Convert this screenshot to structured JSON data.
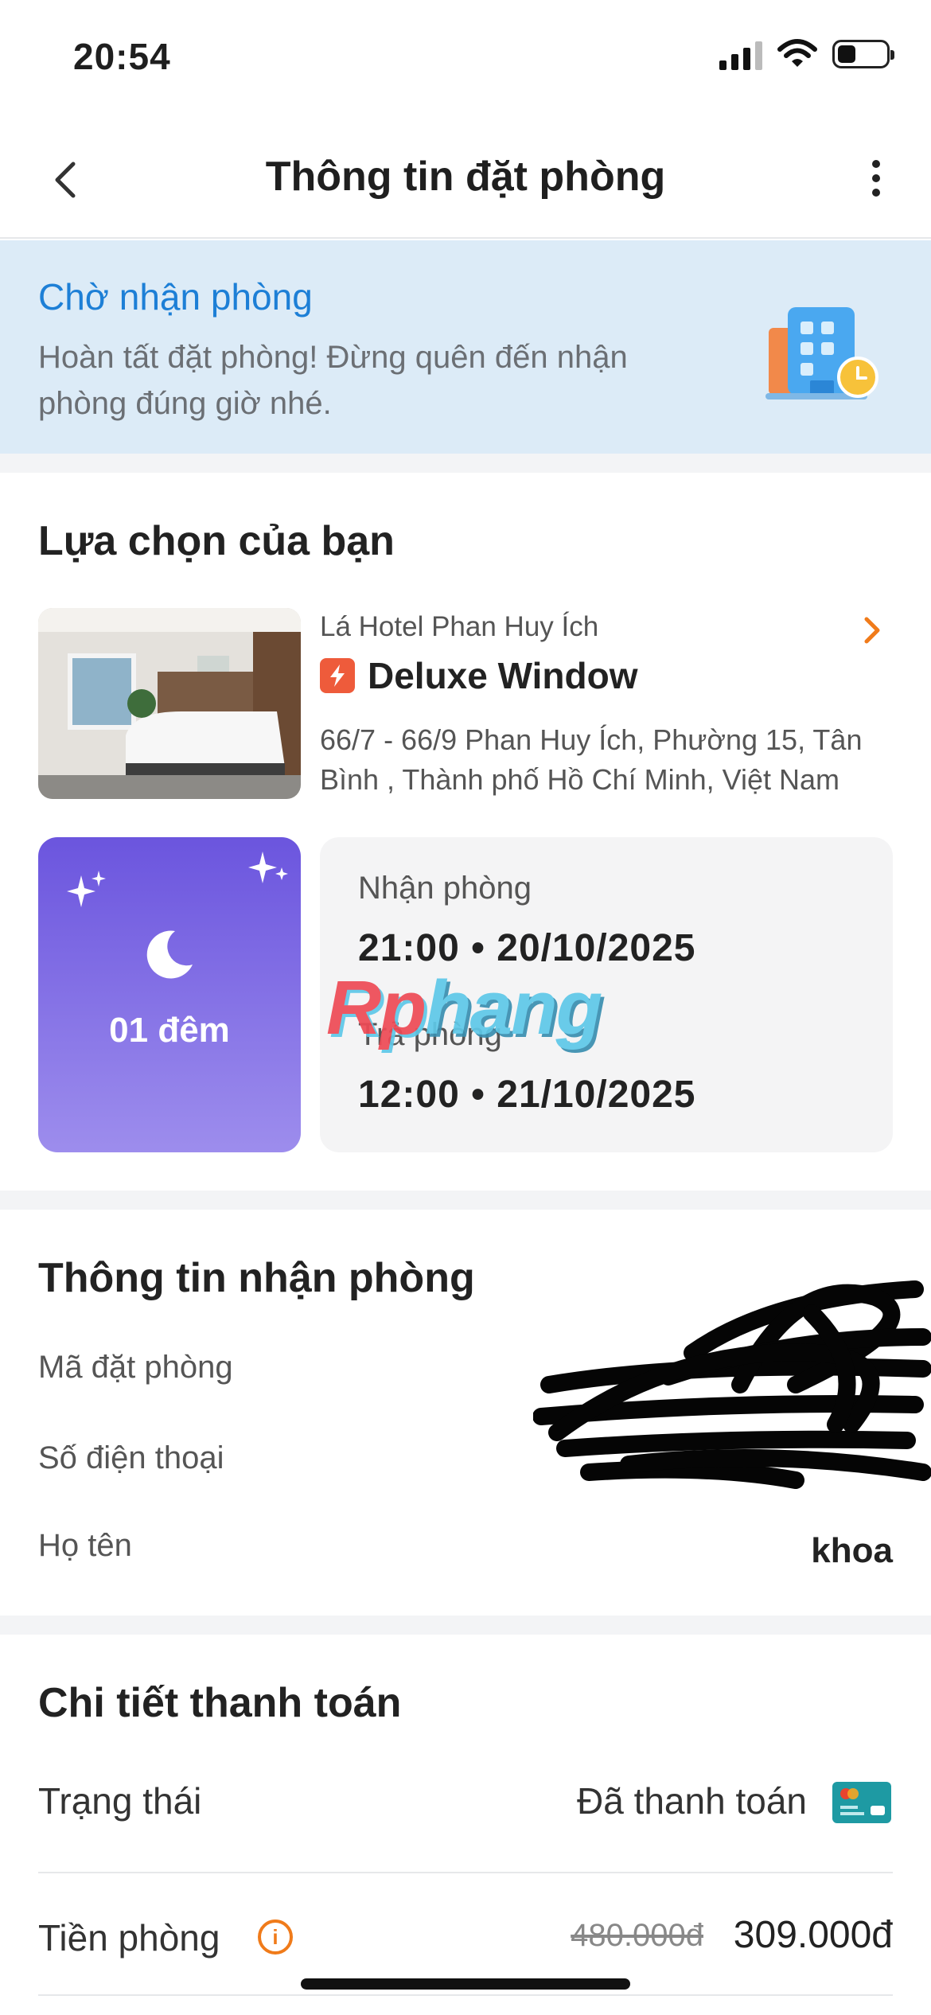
{
  "status_bar": {
    "time": "20:54"
  },
  "nav": {
    "title": "Thông tin đặt phòng"
  },
  "banner": {
    "title": "Chờ nhận phòng",
    "message": "Hoàn tất đặt phòng! Đừng quên đến nhận phòng đúng giờ nhé."
  },
  "selection": {
    "title": "Lựa chọn của bạn",
    "hotel_name": "Lá Hotel Phan Huy Ích",
    "room_name": "Deluxe Window",
    "address": "66/7 - 66/9  Phan Huy Ích, Phường 15, Tân Bình , Thành phố Hồ Chí Minh, Việt Nam",
    "nights": "01 đêm",
    "checkin_label": "Nhận phòng",
    "checkin_value": "21:00  •  20/10/2025",
    "checkout_label": "Trả phòng",
    "checkout_value": "12:00  •  21/10/2025"
  },
  "watermark": {
    "part1": "Rp",
    "part2": "hang"
  },
  "checkin_info": {
    "title": "Thông tin nhận phòng",
    "booking_code_label": "Mã đặt phòng",
    "phone_label": "Số điện thoại",
    "name_label": "Họ tên",
    "name_value": "khoa"
  },
  "payment": {
    "title": "Chi tiết thanh toán",
    "status_label": "Trạng thái",
    "status_value": "Đã thanh toán",
    "room_price_label": "Tiền phòng",
    "info_icon": "i",
    "original_price": "480.000đ",
    "price": "309.000đ"
  },
  "colors": {
    "accent_blue": "#1d7fd6",
    "banner_bg": "#dcebf7",
    "nights_purple": "#6b55de",
    "orange": "#f07b1a",
    "bolt_red": "#ee5b3b"
  }
}
